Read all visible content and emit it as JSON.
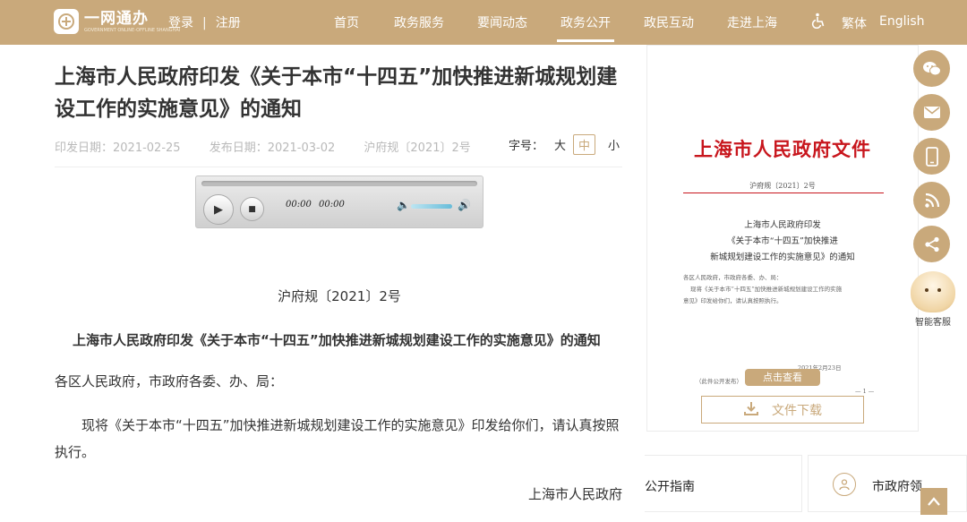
{
  "header": {
    "logo_text": "一网通办",
    "logo_sub": "GOVERNMENT ONLINE-OFFLINE SHANGHAI",
    "login": "登录",
    "separator": "|",
    "register": "注册",
    "nav": [
      {
        "label": "首页"
      },
      {
        "label": "政务服务"
      },
      {
        "label": "要闻动态"
      },
      {
        "label": "政务公开"
      },
      {
        "label": "政民互动"
      },
      {
        "label": "走进上海"
      }
    ],
    "active_nav": "政务公开",
    "accessibility_icon": "wheelchair-icon",
    "traditional": "繁体",
    "english": "English"
  },
  "article": {
    "title": "上海市人民政府印发《关于本市“十四五”加快推进新城规划建设工作的实施意见》的通知",
    "print_date": "印发日期：2021-02-25",
    "publish_date": "发布日期：2021-03-02",
    "doc_number": "沪府规〔2021〕2号",
    "font_size_label": "字号：",
    "font_sizes": [
      "大",
      "中",
      "小"
    ],
    "font_size_selected": "中",
    "body_doc_number": "沪府规〔2021〕2号",
    "body_heading": "上海市人民政府印发《关于本市“十四五”加快推进新城规划建设工作的实施意见》的通知",
    "salutation": "各区人民政府，市政府各委、办、局：",
    "paragraph": "现将《关于本市“十四五”加快推进新城规划建设工作的实施意见》印发给你们，请认真按照执行。",
    "signature": "上海市人民政府"
  },
  "player": {
    "current_time": "00:00",
    "total_time": "00:00",
    "progress": 0
  },
  "preview": {
    "doc_title": "上海市人民政府文件",
    "doc_no": "沪府规〔2021〕2号",
    "sub_line1": "上海市人民政府印发",
    "sub_line2": "《关于本市“十四五”加快推进",
    "sub_line3": "新城规划建设工作的实施意见》的通知",
    "small_line1": "各区人民政府，市政府各委、办、局：",
    "small_line2": "现将《关于本市“十四五”加快推进新城规划建设工作的实施",
    "small_line3": "意见》印发给你们，请认真按照执行。",
    "small_date": "2021年2月23日",
    "small_note": "（此件公开发布）",
    "page_mark": "— 1 —",
    "view_button": "点击查看",
    "download_button": "文件下载"
  },
  "bottom_cards": [
    {
      "label": "公开指南"
    },
    {
      "label": "市政府领"
    }
  ],
  "side_toolbar": {
    "items": [
      "wechat-icon",
      "mail-icon",
      "mobile-icon",
      "rss-icon",
      "share-icon"
    ],
    "assistant_label": "智能客服"
  },
  "colors": {
    "brand": "#c9a97b",
    "doc_red": "#c8161d"
  }
}
